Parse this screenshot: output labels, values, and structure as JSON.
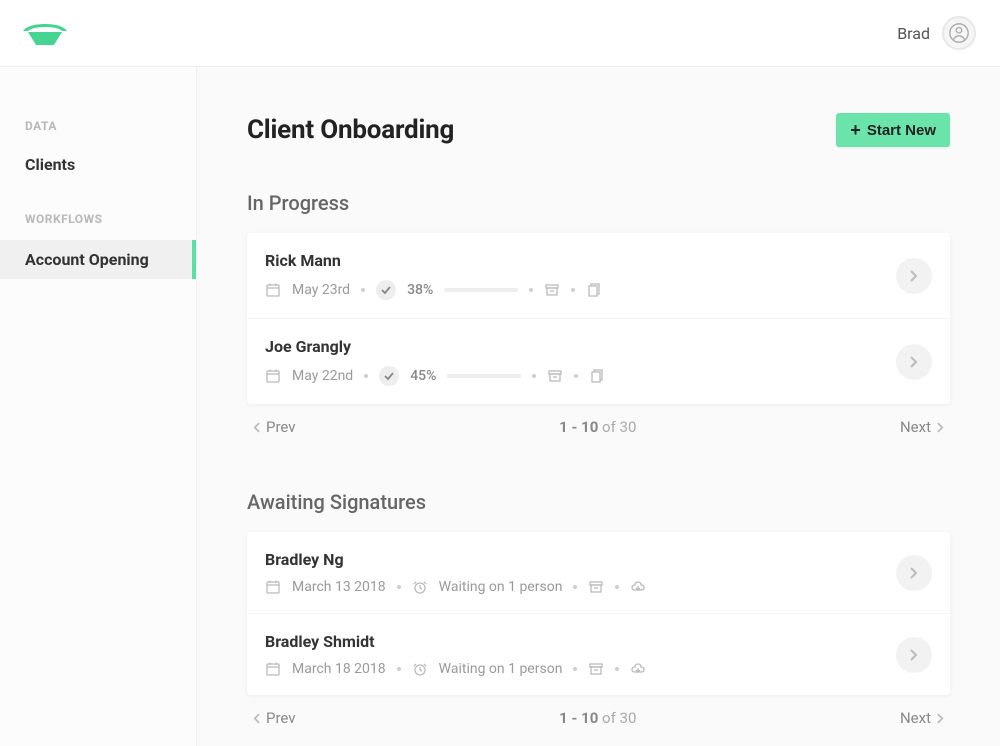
{
  "header": {
    "user_name": "Brad"
  },
  "sidebar": {
    "section1": "DATA",
    "item1": "Clients",
    "section2": "WORKFLOWS",
    "item2": "Account Opening"
  },
  "page": {
    "title": "Client Onboarding",
    "start_new": "Start New"
  },
  "sections": {
    "in_progress": {
      "title": "In Progress",
      "rows": [
        {
          "name": "Rick Mann",
          "date": "May 23rd",
          "pct": "38%",
          "progress": 38
        },
        {
          "name": "Joe Grangly",
          "date": "May 22nd",
          "pct": "45%",
          "progress": 45
        }
      ]
    },
    "awaiting": {
      "title": "Awaiting Signatures",
      "rows": [
        {
          "name": "Bradley Ng",
          "date": "March 13 2018",
          "status": "Waiting on 1 person"
        },
        {
          "name": "Bradley Shmidt",
          "date": "March 18 2018",
          "status": "Waiting on 1 person"
        }
      ]
    }
  },
  "pagination": {
    "prev": "Prev",
    "next": "Next",
    "range": "1 - 10",
    "of": " of 30"
  }
}
